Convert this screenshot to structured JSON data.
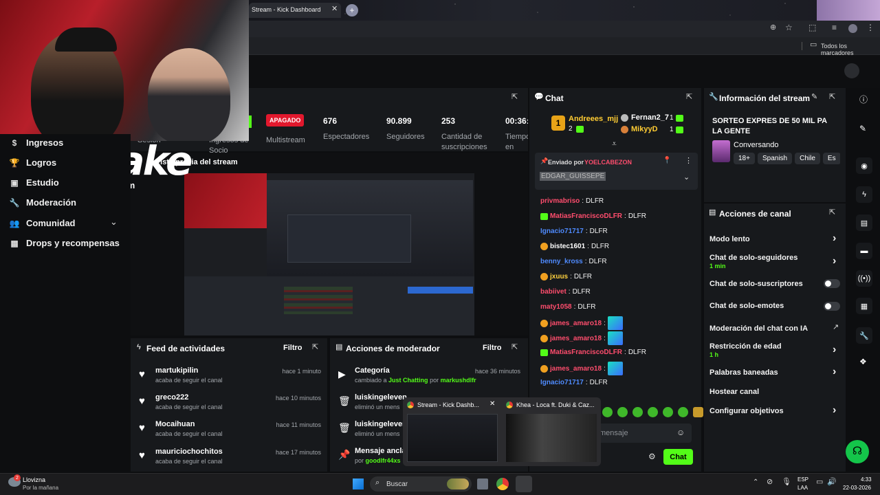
{
  "browser": {
    "tab_title": "Stream - Kick Dashboard",
    "bookmarks_label": "Todos los marcadores"
  },
  "stats": [
    {
      "value": "",
      "label": "Sesión"
    },
    {
      "value": "",
      "label": "Ingresos de Socio"
    },
    {
      "value": "APAGADO",
      "label": "Multistream"
    },
    {
      "value": "676",
      "label": "Espectadores"
    },
    {
      "value": "90.899",
      "label": "Seguidores"
    },
    {
      "value": "253",
      "label": "Cantidad de suscripciones"
    },
    {
      "value": "00:36:",
      "label": "Tiempo en vivo"
    }
  ],
  "preview": {
    "title": "Vista previa del stream"
  },
  "sidebar": {
    "items": [
      {
        "label": "Ingresos",
        "icon": "currency-icon"
      },
      {
        "label": "Logros",
        "icon": "trophy-icon"
      },
      {
        "label": "Estudio",
        "icon": "monitor-icon"
      },
      {
        "label": "Moderación",
        "icon": "wrench-icon"
      },
      {
        "label": "Comunidad",
        "icon": "people-icon"
      },
      {
        "label": "Drops y recompensas",
        "icon": "gift-icon"
      }
    ]
  },
  "logo": {
    "text": "Stake",
    "suffix": ".com"
  },
  "feed": {
    "title": "Feed de actividades",
    "filter": "Filtro",
    "items": [
      {
        "name": "martukipilin",
        "sub": "acaba de seguir el canal",
        "time": "hace 1 minuto"
      },
      {
        "name": "greco222",
        "sub": "acaba de seguir el canal",
        "time": "hace 10 minutos"
      },
      {
        "name": "Mocaihuan",
        "sub": "acaba de seguir el canal",
        "time": "hace 11 minutos"
      },
      {
        "name": "mauriciochochitos",
        "sub": "acaba de seguir el canal",
        "time": "hace 17 minutos"
      }
    ]
  },
  "modactions": {
    "title": "Acciones de moderador",
    "filter": "Filtro",
    "items": [
      {
        "name": "Categoría",
        "sub_pre": "cambiado a",
        "sub_a": "Just Chatting",
        "sub_mid": "por",
        "sub_b": "markushdlfr",
        "time": "hace 36 minutos"
      },
      {
        "name": "luiskingeleven",
        "sub": "eliminó un mens",
        "time": ""
      },
      {
        "name": "luiskingeleven",
        "sub": "eliminó un mens",
        "time": ""
      },
      {
        "name": "Mensaje ancla",
        "sub_pre": "por",
        "sub_b": "goodlfr44xs",
        "time": ""
      }
    ]
  },
  "chat": {
    "title": "Chat",
    "top_gifters": [
      {
        "rank": "1",
        "name": "Andreees_mjj",
        "count": "2"
      },
      {
        "name": "Fernan2_7",
        "count": "1"
      },
      {
        "name": "MikyyD",
        "count": "1"
      }
    ],
    "pinned": {
      "label": "Enviado por",
      "user": "YOELCABEZON",
      "text": "EDGAR_GUISSEPE"
    },
    "messages": [
      {
        "user": "privmabriso",
        "text": "DLFR",
        "color": "#ff4d6d"
      },
      {
        "user": "MatiasFranciscoDLFR",
        "text": "DLFR",
        "color": "#ff4d6d"
      },
      {
        "user": "Ignacio71717",
        "text": "DLFR",
        "color": "#4f8bff"
      },
      {
        "user": "bistec1601",
        "text": "DLFR",
        "color": "#ffffff"
      },
      {
        "user": "benny_kross",
        "text": "DLFR",
        "color": "#4f8bff"
      },
      {
        "user": "jxuus",
        "text": "DLFR",
        "color": "#ffd23f"
      },
      {
        "user": "babiivet",
        "text": "DLFR",
        "color": "#ff4d6d"
      },
      {
        "user": "maty1058",
        "text": "DLFR",
        "color": "#ff4d6d"
      },
      {
        "user": "james_amaro18",
        "text": "",
        "color": "#ff4d6d"
      },
      {
        "user": "james_amaro18",
        "text": "",
        "color": "#ff4d6d"
      },
      {
        "user": "MatiasFranciscoDLFR",
        "text": "DLFR",
        "color": "#ff4d6d"
      },
      {
        "user": "james_amaro18",
        "text": "",
        "color": "#ff4d6d"
      },
      {
        "user": "Ignacio71717",
        "text": "DLFR",
        "color": "#4f8bff"
      }
    ],
    "input_placeholder": "mensaje",
    "send_label": "Chat"
  },
  "info": {
    "title": "Información del stream",
    "stream_title": "SORTEO EXPRES DE 50 MIL PA LA GENTE",
    "category": "Conversando",
    "tags": [
      "18+",
      "Spanish",
      "Chile",
      "Es"
    ]
  },
  "channel_actions": {
    "title": "Acciones de canal",
    "rows": [
      {
        "label": "Modo lento",
        "sub": ""
      },
      {
        "label": "Chat de solo-seguidores",
        "sub": "1 min"
      },
      {
        "label": "Chat de solo-suscriptores",
        "sub": ""
      },
      {
        "label": "Chat de solo-emotes",
        "sub": ""
      },
      {
        "label": "Moderación del chat con IA",
        "sub": ""
      },
      {
        "label": "Restricción de edad",
        "sub": "1 h"
      },
      {
        "label": "Palabras baneadas",
        "sub": ""
      },
      {
        "label": "Hostear canal",
        "sub": ""
      },
      {
        "label": "Configurar objetivos",
        "sub": ""
      }
    ]
  },
  "thumbnails": [
    {
      "title": "Stream - Kick Dashb..."
    },
    {
      "title": "Khea - Loca ft. Duki & Caz..."
    }
  ],
  "taskbar": {
    "weather_temp": "Llovizna",
    "weather_sub": "Por la mañana",
    "search_placeholder": "Buscar",
    "lang": "ESP",
    "lang_sub": "LAA",
    "time": "4:33",
    "date": "22-03-2026",
    "weather_badge": "2"
  },
  "colors": {
    "accent": "#53fc18",
    "live_off": "#e2182d"
  }
}
